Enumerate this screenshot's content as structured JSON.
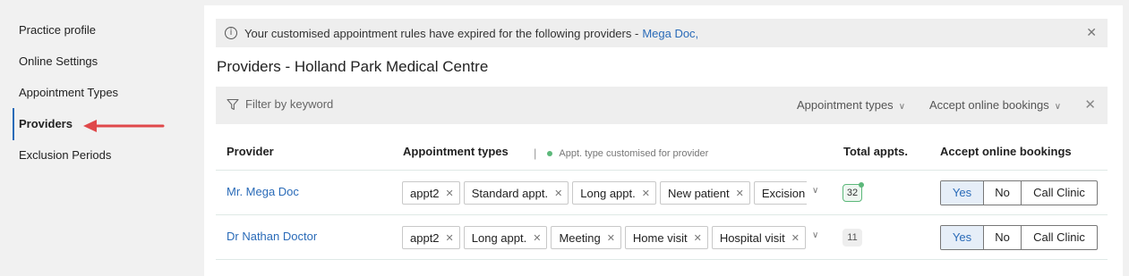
{
  "sidebar": {
    "items": [
      {
        "label": "Practice profile"
      },
      {
        "label": "Online Settings"
      },
      {
        "label": "Appointment Types"
      },
      {
        "label": "Providers"
      },
      {
        "label": "Exclusion Periods"
      }
    ]
  },
  "alert": {
    "text": "Your customised appointment rules have expired for the following providers -",
    "link": "Mega Doc,"
  },
  "page_title": "Providers - Holland Park Medical Centre",
  "filters": {
    "keyword_placeholder": "Filter by keyword",
    "appointment_types": "Appointment types",
    "accept_online": "Accept online bookings"
  },
  "table": {
    "headers": {
      "provider": "Provider",
      "appointment_types": "Appointment types",
      "legend_sep": "|",
      "legend": "Appt. type customised for provider",
      "total": "Total appts.",
      "accept": "Accept online bookings"
    },
    "rows": [
      {
        "provider": "Mr. Mega Doc",
        "chips": [
          "appt2",
          "Standard appt.",
          "Long appt.",
          "New patient",
          "Excision"
        ],
        "total": "32",
        "yes": "Yes",
        "no": "No",
        "call": "Call Clinic"
      },
      {
        "provider": "Dr Nathan Doctor",
        "chips": [
          "appt2",
          "Long appt.",
          "Meeting",
          "Home visit",
          "Hospital visit"
        ],
        "total": "11",
        "yes": "Yes",
        "no": "No",
        "call": "Call Clinic"
      }
    ]
  },
  "colors": {
    "accent": "#2a6bb8",
    "arrow": "#e0484a",
    "customised_dot": "#5cb87a"
  }
}
